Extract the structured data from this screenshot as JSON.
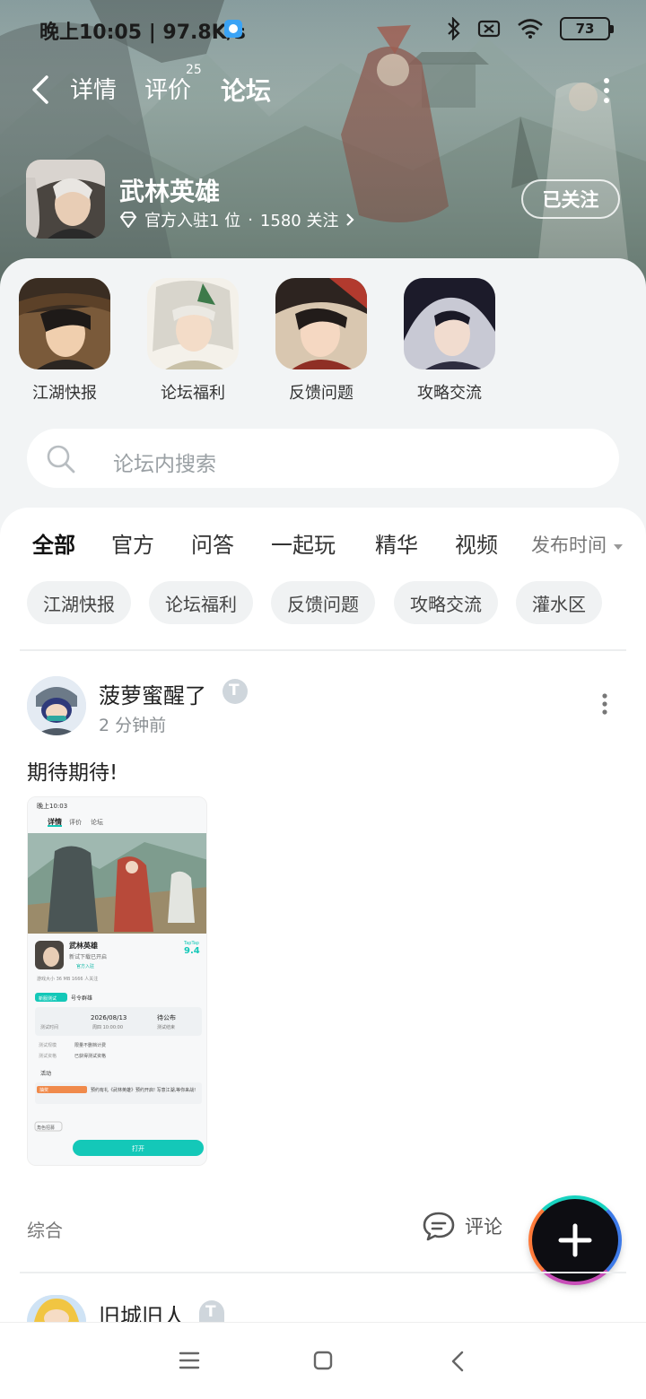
{
  "status_bar": {
    "time_speed": "晚上10:05 | 97.8K/s",
    "battery": "73"
  },
  "nav": {
    "tabs": [
      {
        "label": "详情"
      },
      {
        "label": "评价",
        "badge": "25"
      },
      {
        "label": "论坛",
        "active": true
      }
    ]
  },
  "game": {
    "title": "武林英雄",
    "meta_official": "官方入驻1 位",
    "meta_sep": "·",
    "meta_followers": "1580 关注",
    "follow_label": "已关注"
  },
  "quick_links": [
    {
      "label": "江湖快报"
    },
    {
      "label": "论坛福利"
    },
    {
      "label": "反馈问题"
    },
    {
      "label": "攻略交流"
    }
  ],
  "search": {
    "placeholder": "论坛内搜索"
  },
  "feed_tabs": [
    {
      "label": "全部",
      "active": true
    },
    {
      "label": "官方"
    },
    {
      "label": "问答"
    },
    {
      "label": "一起玩"
    },
    {
      "label": "精华"
    },
    {
      "label": "视频"
    }
  ],
  "sort": {
    "label": "发布时间"
  },
  "chips": [
    "江湖快报",
    "论坛福利",
    "反馈问题",
    "攻略交流",
    "灌水区"
  ],
  "posts": [
    {
      "author": "菠萝蜜醒了",
      "time": "2 分钟前",
      "body": "期待期待!",
      "category": "综合",
      "comment_label": "评论",
      "screenshot": {
        "time": "晚上10:03",
        "tabs": [
          "详情",
          "评价",
          "论坛"
        ],
        "rating_brand": "TapTap",
        "rating": "9.4",
        "game_title": "武林英雄",
        "subtitle": "新试下载已开启",
        "official": "官方入驻",
        "stats": "游戏大小 36 MB   1666 人关注",
        "test_badge": "新服测试",
        "test_type": "号令群雄",
        "date_label": "测试时间",
        "date_value": "2026/08/13",
        "date_sub": "周四 10:00:00",
        "end_value": "待公布",
        "end_sub": "测试结束",
        "scale_label": "测试规模",
        "scale_value": "限量不删档计费",
        "qual_label": "测试资格",
        "qual_value": "已获得测试资格",
        "activity": "活动",
        "activity_tag": "抽奖",
        "activity_text": "预约有礼《武林英雄》预约开启! 写意江湖,等你来战!",
        "role_test": "角色招募",
        "open_label": "打开"
      }
    },
    {
      "author": "旧城旧人"
    }
  ],
  "colors": {
    "accent": "#14c8b8",
    "page_bg": "#f2f4f5",
    "card_bg": "#ffffff"
  }
}
